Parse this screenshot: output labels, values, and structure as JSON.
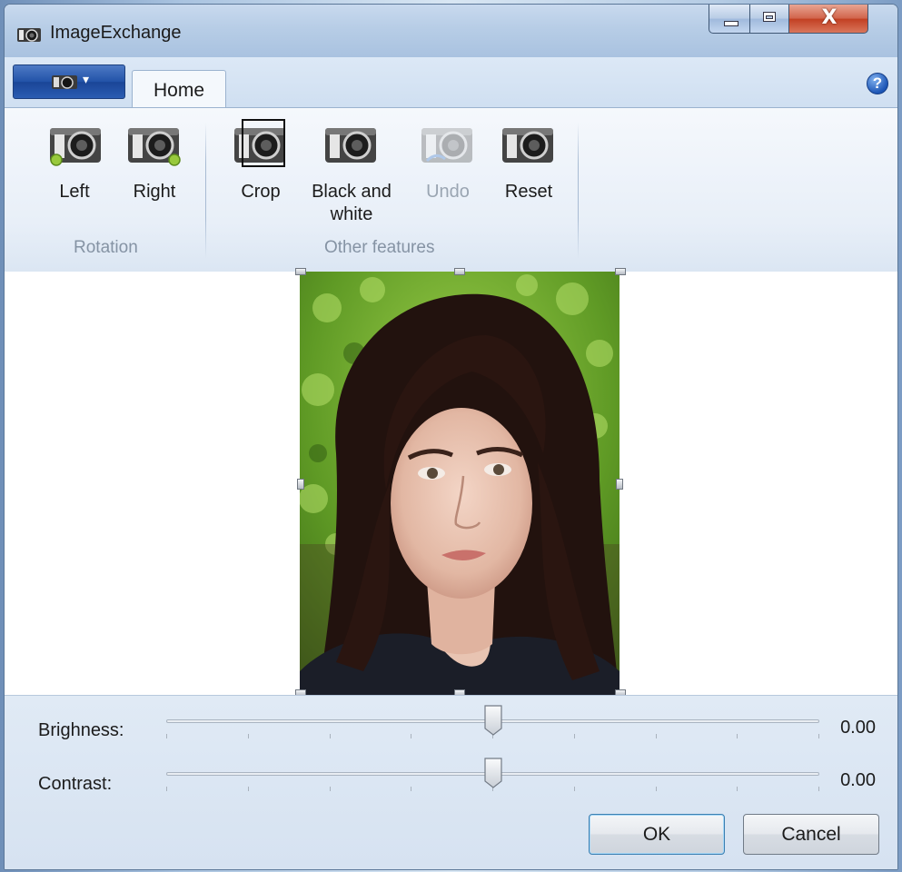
{
  "window": {
    "title": "ImageExchange",
    "minimize_icon": "minimize-icon",
    "maximize_icon": "maximize-icon",
    "close_icon": "close-icon",
    "close_glyph": "X"
  },
  "ribbon": {
    "app_menu_arrow": "▾",
    "tabs": [
      {
        "label": "Home"
      }
    ],
    "help_glyph": "?",
    "groups": [
      {
        "label": "Rotation",
        "buttons": [
          {
            "label": "Left"
          },
          {
            "label": "Right"
          }
        ]
      },
      {
        "label": "Other features",
        "buttons": [
          {
            "label": "Crop"
          },
          {
            "label": "Black and white"
          },
          {
            "label": "Undo",
            "enabled": false
          },
          {
            "label": "Reset"
          }
        ]
      }
    ]
  },
  "adjustments": {
    "brightness": {
      "label": "Brighness:",
      "value": "0.00",
      "position": 0.5
    },
    "contrast": {
      "label": "Contrast:",
      "value": "0.00",
      "position": 0.5
    }
  },
  "dialog_buttons": {
    "ok": "OK",
    "cancel": "Cancel"
  },
  "colors": {
    "accent": "#2253a8",
    "close": "#c23f22",
    "foliage": "#6fa62c",
    "hair": "#24130f",
    "skin": "#e9c3b1"
  }
}
